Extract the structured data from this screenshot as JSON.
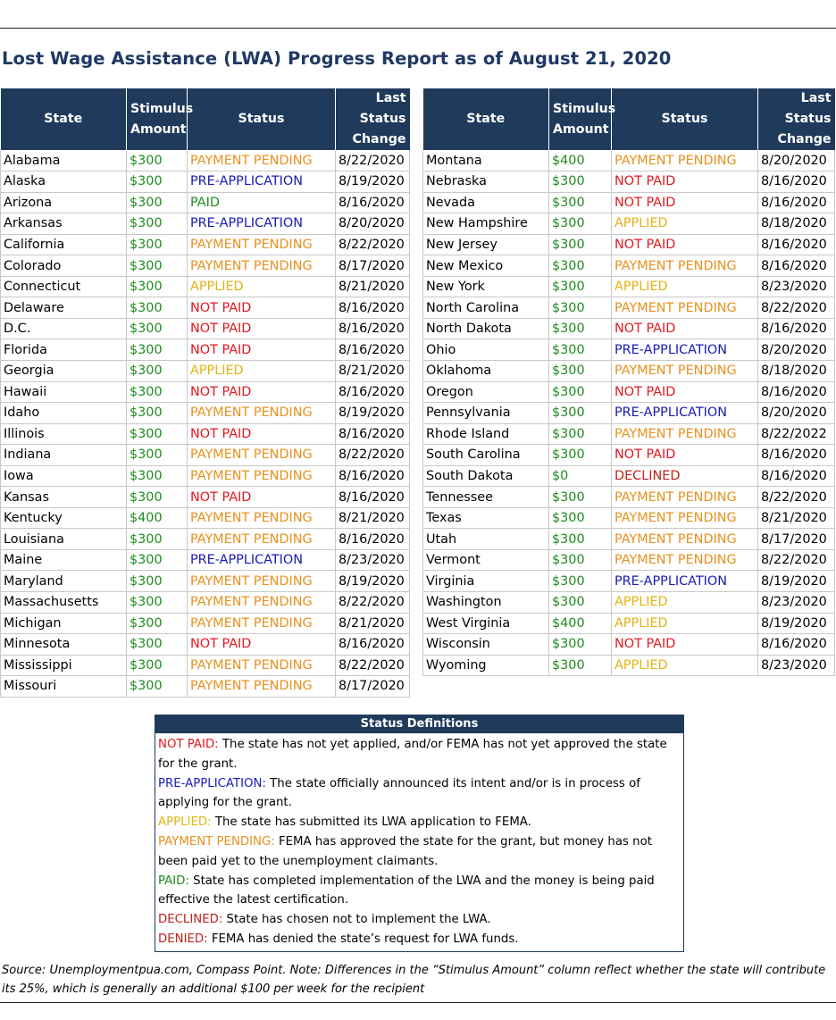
{
  "title": "Lost Wage Assistance (LWA) Progress Report as of August 21, 2020",
  "columns": {
    "state": "State",
    "amount": "Stimulus Amount",
    "status": "Status",
    "change": "Last Status Change"
  },
  "status_colors": {
    "PAID": "#1e8b1e",
    "NOT PAID": "#e2171f",
    "PRE-APPLICATION": "#1a1ab8",
    "APPLIED": "#e2b413",
    "PAYMENT PENDING": "#e8901e",
    "DECLINED": "#c0211b",
    "DENIED": "#c0211b"
  },
  "left_rows": [
    {
      "state": "Alabama",
      "amount": "$300",
      "status": "PAYMENT PENDING",
      "date": "8/22/2020"
    },
    {
      "state": "Alaska",
      "amount": "$300",
      "status": "PRE-APPLICATION",
      "date": "8/19/2020"
    },
    {
      "state": "Arizona",
      "amount": "$300",
      "status": "PAID",
      "date": "8/16/2020"
    },
    {
      "state": "Arkansas",
      "amount": "$300",
      "status": "PRE-APPLICATION",
      "date": "8/20/2020"
    },
    {
      "state": "California",
      "amount": "$300",
      "status": "PAYMENT PENDING",
      "date": "8/22/2020"
    },
    {
      "state": "Colorado",
      "amount": "$300",
      "status": "PAYMENT PENDING",
      "date": "8/17/2020"
    },
    {
      "state": "Connecticut",
      "amount": "$300",
      "status": "APPLIED",
      "date": "8/21/2020"
    },
    {
      "state": "Delaware",
      "amount": "$300",
      "status": "NOT PAID",
      "date": "8/16/2020"
    },
    {
      "state": "D.C.",
      "amount": "$300",
      "status": "NOT PAID",
      "date": "8/16/2020"
    },
    {
      "state": "Florida",
      "amount": "$300",
      "status": "NOT PAID",
      "date": "8/16/2020"
    },
    {
      "state": "Georgia",
      "amount": "$300",
      "status": "APPLIED",
      "date": "8/21/2020"
    },
    {
      "state": "Hawaii",
      "amount": "$300",
      "status": "NOT PAID",
      "date": "8/16/2020"
    },
    {
      "state": "Idaho",
      "amount": "$300",
      "status": "PAYMENT PENDING",
      "date": "8/19/2020"
    },
    {
      "state": "Illinois",
      "amount": "$300",
      "status": "NOT PAID",
      "date": "8/16/2020"
    },
    {
      "state": "Indiana",
      "amount": "$300",
      "status": "PAYMENT PENDING",
      "date": "8/22/2020"
    },
    {
      "state": "Iowa",
      "amount": "$300",
      "status": "PAYMENT PENDING",
      "date": "8/16/2020"
    },
    {
      "state": "Kansas",
      "amount": "$300",
      "status": "NOT PAID",
      "date": "8/16/2020"
    },
    {
      "state": "Kentucky",
      "amount": "$400",
      "status": "PAYMENT PENDING",
      "date": "8/21/2020"
    },
    {
      "state": "Louisiana",
      "amount": "$300",
      "status": "PAYMENT PENDING",
      "date": "8/16/2020"
    },
    {
      "state": "Maine",
      "amount": "$300",
      "status": "PRE-APPLICATION",
      "date": "8/23/2020"
    },
    {
      "state": "Maryland",
      "amount": "$300",
      "status": "PAYMENT PENDING",
      "date": "8/19/2020"
    },
    {
      "state": "Massachusetts",
      "amount": "$300",
      "status": "PAYMENT PENDING",
      "date": "8/22/2020"
    },
    {
      "state": "Michigan",
      "amount": "$300",
      "status": "PAYMENT PENDING",
      "date": "8/21/2020"
    },
    {
      "state": "Minnesota",
      "amount": "$300",
      "status": "NOT PAID",
      "date": "8/16/2020"
    },
    {
      "state": "Mississippi",
      "amount": "$300",
      "status": "PAYMENT PENDING",
      "date": "8/22/2020"
    },
    {
      "state": "Missouri",
      "amount": "$300",
      "status": "PAYMENT PENDING",
      "date": "8/17/2020"
    }
  ],
  "right_rows": [
    {
      "state": "Montana",
      "amount": "$400",
      "status": "PAYMENT PENDING",
      "date": "8/20/2020"
    },
    {
      "state": "Nebraska",
      "amount": "$300",
      "status": "NOT PAID",
      "date": "8/16/2020"
    },
    {
      "state": "Nevada",
      "amount": "$300",
      "status": "NOT PAID",
      "date": "8/16/2020"
    },
    {
      "state": "New Hampshire",
      "amount": "$300",
      "status": "APPLIED",
      "date": "8/18/2020"
    },
    {
      "state": "New Jersey",
      "amount": "$300",
      "status": "NOT PAID",
      "date": "8/16/2020"
    },
    {
      "state": "New Mexico",
      "amount": "$300",
      "status": "PAYMENT PENDING",
      "date": "8/16/2020"
    },
    {
      "state": "New York",
      "amount": "$300",
      "status": "APPLIED",
      "date": "8/23/2020"
    },
    {
      "state": "North Carolina",
      "amount": "$300",
      "status": "PAYMENT PENDING",
      "date": "8/22/2020"
    },
    {
      "state": "North Dakota",
      "amount": "$300",
      "status": "NOT PAID",
      "date": "8/16/2020"
    },
    {
      "state": "Ohio",
      "amount": "$300",
      "status": "PRE-APPLICATION",
      "date": "8/20/2020"
    },
    {
      "state": "Oklahoma",
      "amount": "$300",
      "status": "PAYMENT PENDING",
      "date": "8/18/2020"
    },
    {
      "state": "Oregon",
      "amount": "$300",
      "status": "NOT PAID",
      "date": "8/16/2020"
    },
    {
      "state": "Pennsylvania",
      "amount": "$300",
      "status": "PRE-APPLICATION",
      "date": "8/20/2020"
    },
    {
      "state": "Rhode Island",
      "amount": "$300",
      "status": "PAYMENT PENDING",
      "date": "8/22/2022"
    },
    {
      "state": "South Carolina",
      "amount": "$300",
      "status": "NOT PAID",
      "date": "8/16/2020"
    },
    {
      "state": "South Dakota",
      "amount": "$0",
      "status": "DECLINED",
      "date": "8/16/2020"
    },
    {
      "state": "Tennessee",
      "amount": "$300",
      "status": "PAYMENT PENDING",
      "date": "8/22/2020"
    },
    {
      "state": "Texas",
      "amount": "$300",
      "status": "PAYMENT PENDING",
      "date": "8/21/2020"
    },
    {
      "state": "Utah",
      "amount": "$300",
      "status": "PAYMENT PENDING",
      "date": "8/17/2020"
    },
    {
      "state": "Vermont",
      "amount": "$300",
      "status": "PAYMENT PENDING",
      "date": "8/22/2020"
    },
    {
      "state": "Virginia",
      "amount": "$300",
      "status": "PRE-APPLICATION",
      "date": "8/19/2020"
    },
    {
      "state": "Washington",
      "amount": "$300",
      "status": "APPLIED",
      "date": "8/23/2020"
    },
    {
      "state": "West Virginia",
      "amount": "$400",
      "status": "APPLIED",
      "date": "8/19/2020"
    },
    {
      "state": "Wisconsin",
      "amount": "$300",
      "status": "NOT PAID",
      "date": "8/16/2020"
    },
    {
      "state": "Wyoming",
      "amount": "$300",
      "status": "APPLIED",
      "date": "8/23/2020"
    }
  ],
  "definitions": {
    "heading": "Status Definitions",
    "items": [
      {
        "term": "NOT PAID:",
        "text": " The state has not yet applied, and/or FEMA has not yet approved the state for the grant."
      },
      {
        "term": "PRE-APPLICATION:",
        "text": " The state officially announced its intent and/or is in process of applying for the grant."
      },
      {
        "term": "APPLIED:",
        "text": " The state has submitted its LWA application to FEMA."
      },
      {
        "term": "PAYMENT PENDING:",
        "text": " FEMA has approved the state for the grant, but money has not been paid yet to the unemployment claimants."
      },
      {
        "term": "PAID:",
        "text": " State has completed implementation of the LWA and the money is being paid effective the latest certification."
      },
      {
        "term": "DECLINED:",
        "text": " State has chosen not to implement the LWA."
      },
      {
        "term": "DENIED:",
        "text": " FEMA has denied the state’s request for LWA funds."
      }
    ]
  },
  "source_note": "Source: Unemploymentpua.com, Compass Point. Note: Differences in the “Stimulus Amount” column reflect whether the state will contribute its 25%, which is generally an additional $100 per week for the recipient"
}
